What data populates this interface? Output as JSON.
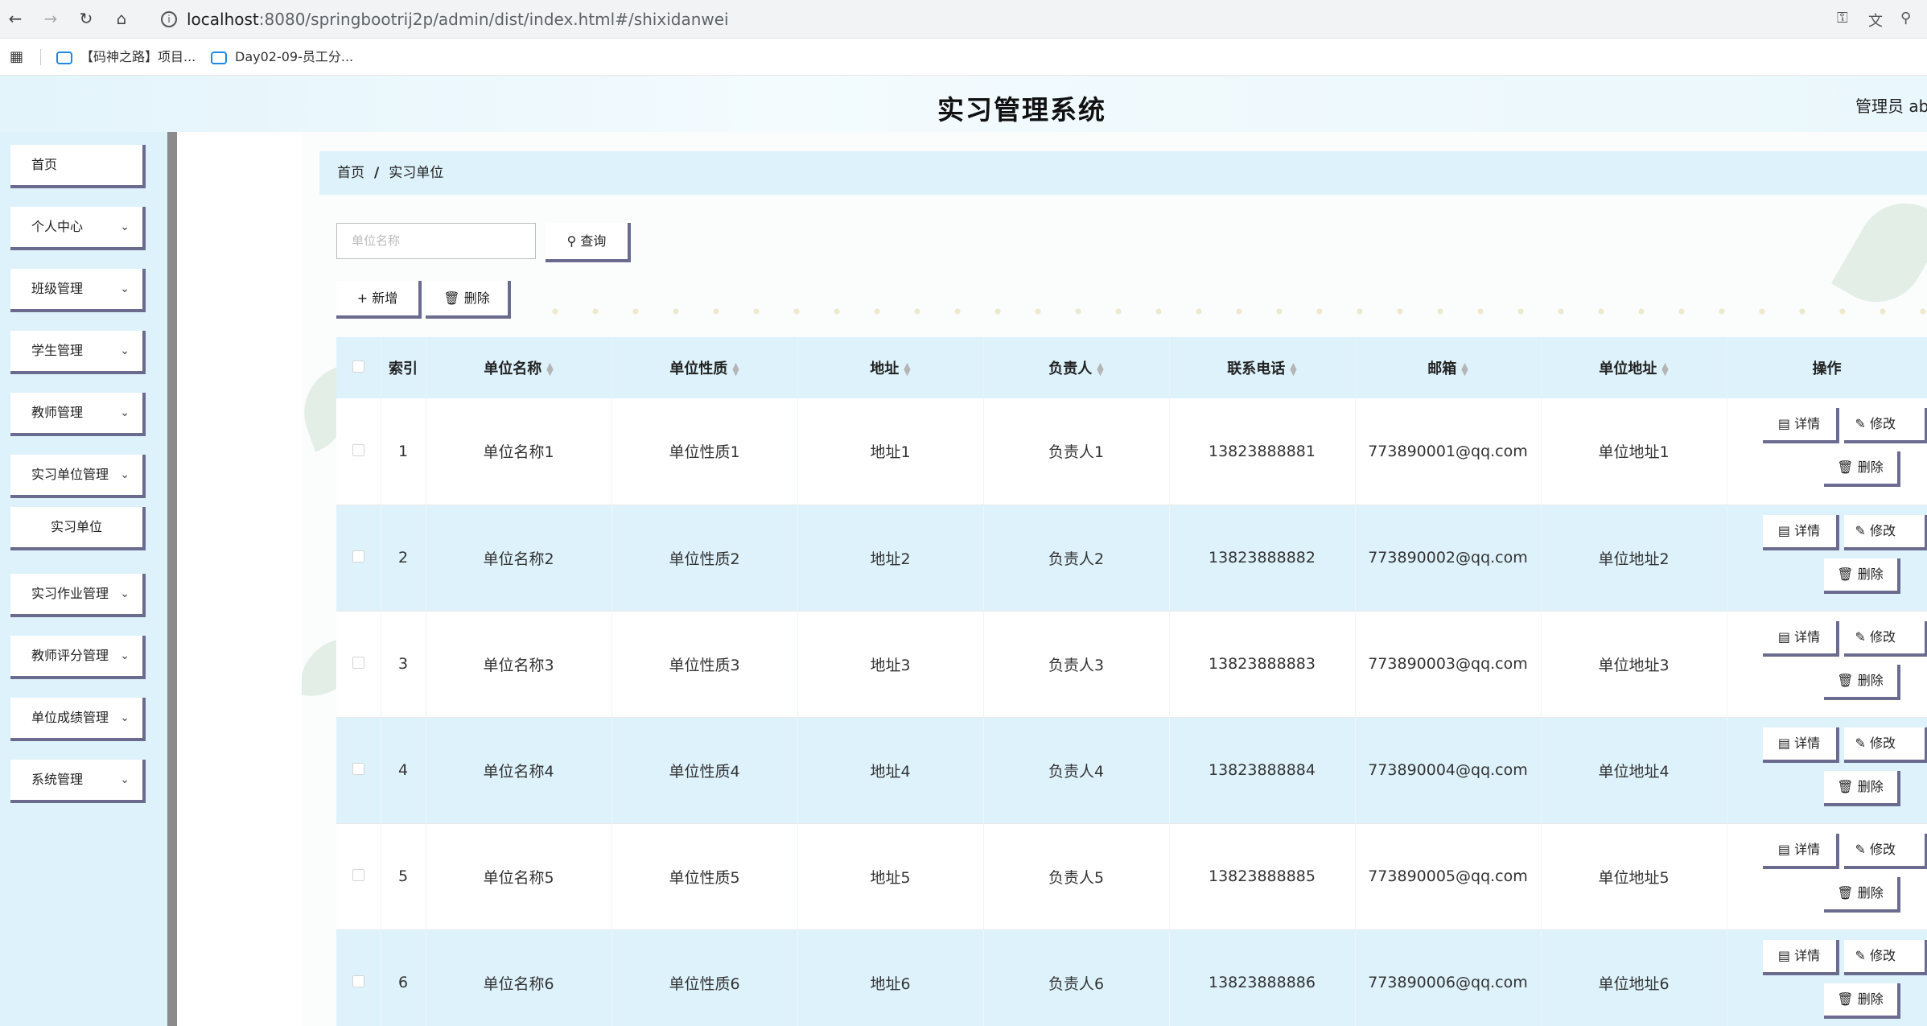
{
  "browser": {
    "url_host": "localhost",
    "url_rest": ":8080/springbootrij2p/admin/dist/index.html#/shixidanwei",
    "bookmarks": [
      "【码神之路】项目...",
      "Day02-09-员工分..."
    ]
  },
  "header": {
    "title": "实习管理系统",
    "user": "管理员 abc"
  },
  "sidebar": {
    "items": [
      {
        "label": "首页",
        "has_children": false
      },
      {
        "label": "个人中心",
        "has_children": true
      },
      {
        "label": "班级管理",
        "has_children": true
      },
      {
        "label": "学生管理",
        "has_children": true
      },
      {
        "label": "教师管理",
        "has_children": true
      },
      {
        "label": "实习单位管理",
        "has_children": true
      },
      {
        "label": "实习单位",
        "has_children": false,
        "sub": true
      },
      {
        "label": "实习作业管理",
        "has_children": true
      },
      {
        "label": "教师评分管理",
        "has_children": true
      },
      {
        "label": "单位成绩管理",
        "has_children": true
      },
      {
        "label": "系统管理",
        "has_children": true
      }
    ]
  },
  "breadcrumb": {
    "home": "首页",
    "sep": "/",
    "current": "实习单位"
  },
  "search": {
    "placeholder": "单位名称",
    "button": "查询"
  },
  "toolbar": {
    "add": "新增",
    "delete": "删除"
  },
  "table": {
    "columns": [
      "索引",
      "单位名称",
      "单位性质",
      "地址",
      "负责人",
      "联系电话",
      "邮箱",
      "单位地址",
      "操作"
    ],
    "rows": [
      {
        "index": "1",
        "name": "单位名称1",
        "nature": "单位性质1",
        "address": "地址1",
        "manager": "负责人1",
        "phone": "13823888881",
        "email": "773890001@qq.com",
        "unit_address": "单位地址1"
      },
      {
        "index": "2",
        "name": "单位名称2",
        "nature": "单位性质2",
        "address": "地址2",
        "manager": "负责人2",
        "phone": "13823888882",
        "email": "773890002@qq.com",
        "unit_address": "单位地址2"
      },
      {
        "index": "3",
        "name": "单位名称3",
        "nature": "单位性质3",
        "address": "地址3",
        "manager": "负责人3",
        "phone": "13823888883",
        "email": "773890003@qq.com",
        "unit_address": "单位地址3"
      },
      {
        "index": "4",
        "name": "单位名称4",
        "nature": "单位性质4",
        "address": "地址4",
        "manager": "负责人4",
        "phone": "13823888884",
        "email": "773890004@qq.com",
        "unit_address": "单位地址4"
      },
      {
        "index": "5",
        "name": "单位名称5",
        "nature": "单位性质5",
        "address": "地址5",
        "manager": "负责人5",
        "phone": "13823888885",
        "email": "773890005@qq.com",
        "unit_address": "单位地址5"
      },
      {
        "index": "6",
        "name": "单位名称6",
        "nature": "单位性质6",
        "address": "地址6",
        "manager": "负责人6",
        "phone": "13823888886",
        "email": "773890006@qq.com",
        "unit_address": "单位地址6"
      }
    ],
    "actions": {
      "detail": "详情",
      "edit": "修改",
      "delete": "删除"
    }
  },
  "colors": {
    "accent_light": "#ddf2fb",
    "button_shadow": "#6b6b90",
    "rail": "#8b8b8b"
  }
}
